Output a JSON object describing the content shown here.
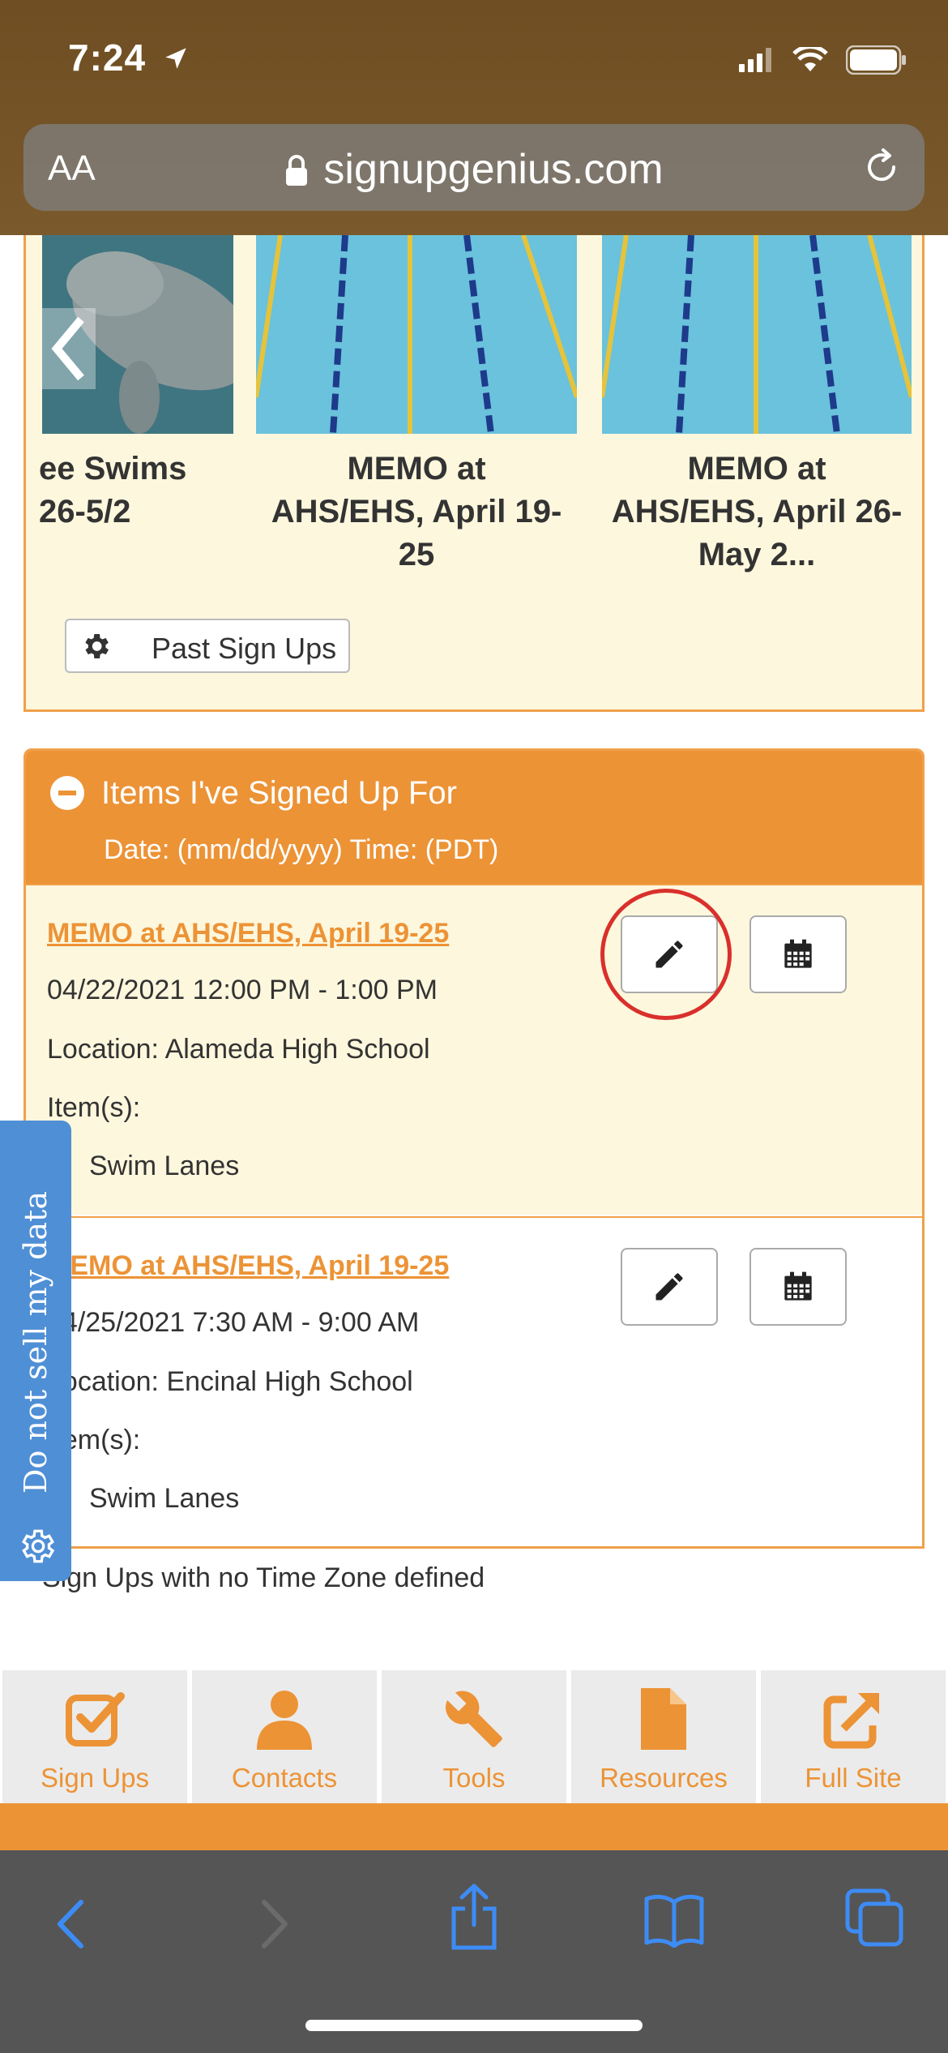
{
  "status_bar": {
    "time": "7:24"
  },
  "browser": {
    "text_size_label": "AA",
    "url": "signupgenius.com"
  },
  "carousel": {
    "tiles": [
      {
        "title": "…ee Swims\n…26-5/2",
        "line1": "ee Swims",
        "line2": "26-5/2"
      },
      {
        "line1": "MEMO at",
        "line2": "AHS/EHS, April 19-",
        "line3": "25"
      },
      {
        "line1": "MEMO at",
        "line2": "AHS/EHS, April 26-",
        "line3": "May 2..."
      }
    ],
    "past_signups_label": "Past Sign Ups"
  },
  "signed_up": {
    "title": "Items I've Signed Up For",
    "subtitle": "Date: (mm/dd/yyyy) Time: (PDT)",
    "items": [
      {
        "link": "MEMO at AHS/EHS, April 19-25",
        "datetime": "04/22/2021 12:00 PM - 1:00 PM",
        "location": "Location: Alameda High School",
        "items_label": "Item(s):",
        "item": "Swim Lanes"
      },
      {
        "link": "MEMO at AHS/EHS, April 19-25",
        "datetime": "04/25/2021 7:30 AM - 9:00 AM",
        "location": "Location: Encinal High School",
        "items_label": "Item(s):",
        "item": "Swim Lanes"
      }
    ],
    "note": "Sign Ups with no Time Zone defined"
  },
  "privacy_tab": {
    "label": "Do not sell my data"
  },
  "bottom_nav": [
    {
      "label": "Sign Ups",
      "icon": "checkbox-icon"
    },
    {
      "label": "Contacts",
      "icon": "person-icon"
    },
    {
      "label": "Tools",
      "icon": "wrench-icon"
    },
    {
      "label": "Resources",
      "icon": "document-icon"
    },
    {
      "label": "Full Site",
      "icon": "external-link-icon"
    }
  ],
  "colors": {
    "accent": "#ec9336",
    "panel": "#fdf7dd",
    "link_blue": "#4f8fd6",
    "highlight": "#d9302c"
  }
}
